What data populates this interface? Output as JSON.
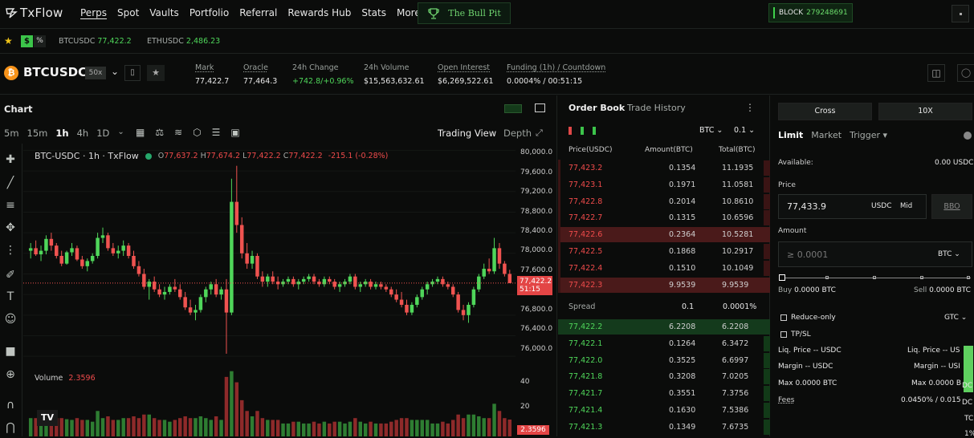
{
  "nav": {
    "logo": "TxFlow",
    "links": [
      "Perps",
      "Spot",
      "Vaults",
      "Portfolio",
      "Referral",
      "Rewards Hub",
      "Stats",
      "More"
    ],
    "bull_pit": "The Bull Pit",
    "block_label": "BLOCK",
    "block_number": "279248691"
  },
  "tickers": {
    "usd_badge": "$",
    "pct_badge": "%",
    "items": [
      {
        "symbol": "BTCUSDC",
        "price": "77,422.2"
      },
      {
        "symbol": "ETHUSDC",
        "price": "2,486.23"
      }
    ]
  },
  "market": {
    "symbol": "BTCUSDC",
    "leverage": "50x",
    "stats": [
      {
        "label": "Mark",
        "value": "77,422.7",
        "color": "#e8e8e8"
      },
      {
        "label": "Oracle",
        "value": "77,464.3",
        "color": "#e8e8e8"
      },
      {
        "label": "24h Change",
        "value": "+742.8/+0.96%",
        "color": "#4fd65a"
      },
      {
        "label": "24h Volume",
        "value": "$15,563,632.61",
        "color": "#e8e8e8"
      },
      {
        "label": "Open Interest",
        "value": "$6,269,522.61",
        "color": "#e8e8e8"
      },
      {
        "label": "Funding (1h) / Countdown",
        "value": "0.0004% / 00:51:15",
        "color": "#e8e8e8"
      }
    ]
  },
  "chart": {
    "title": "Chart",
    "intervals": [
      "5m",
      "15m",
      "1h",
      "4h",
      "1D"
    ],
    "active_interval": "1h",
    "view_tabs": [
      "Trading View",
      "Depth"
    ],
    "legend_symbol": "BTC-USDC · 1h · TxFlow",
    "ohlc": {
      "o": "77,637.2",
      "h": "77,674.2",
      "l": "77,422.2",
      "c": "77,422.2",
      "chg": "-215.1 (-0.28%)"
    },
    "price_ticks": [
      "80,000.0",
      "79,600.0",
      "79,200.0",
      "78,800.0",
      "78,400.0",
      "78,000.0",
      "77,600.0",
      "76,800.0",
      "76,400.0",
      "76,000.0"
    ],
    "current_price": "77,422.2",
    "countdown": "51:15",
    "volume_label": "Volume",
    "volume_value": "2.3596",
    "volume_ticks": [
      "40",
      "20"
    ],
    "volume_marker": "2.3596"
  },
  "chart_data": {
    "type": "candlestick",
    "ylim": [
      75800,
      80100
    ],
    "candles": [
      [
        78050,
        78200,
        77900,
        78100
      ],
      [
        78100,
        78250,
        77950,
        77980
      ],
      [
        77980,
        78150,
        77850,
        78050
      ],
      [
        78050,
        78350,
        77980,
        78280
      ],
      [
        78280,
        78400,
        78050,
        78150
      ],
      [
        78150,
        78200,
        77900,
        77950
      ],
      [
        77950,
        78050,
        77750,
        77800
      ],
      [
        77800,
        78050,
        77780,
        78020
      ],
      [
        78020,
        78200,
        77950,
        78100
      ],
      [
        78100,
        78150,
        77850,
        77880
      ],
      [
        77880,
        77950,
        77700,
        77750
      ],
      [
        77750,
        77900,
        77650,
        77850
      ],
      [
        77850,
        78000,
        77800,
        77950
      ],
      [
        77950,
        78400,
        77900,
        78300
      ],
      [
        78300,
        78500,
        78200,
        78350
      ],
      [
        78350,
        78400,
        78050,
        78100
      ],
      [
        78100,
        78200,
        77950,
        78000
      ],
      [
        78000,
        78150,
        77900,
        78050
      ],
      [
        78050,
        78250,
        77950,
        78150
      ],
      [
        78150,
        78200,
        77900,
        77950
      ],
      [
        77950,
        78050,
        77700,
        77750
      ],
      [
        77750,
        77850,
        77550,
        77600
      ],
      [
        77600,
        77700,
        77300,
        77350
      ],
      [
        77350,
        77500,
        77100,
        77450
      ],
      [
        77450,
        77550,
        77250,
        77300
      ],
      [
        77300,
        77400,
        77150,
        77200
      ],
      [
        77200,
        77350,
        77100,
        77250
      ],
      [
        77250,
        77400,
        77200,
        77350
      ],
      [
        77350,
        77500,
        77250,
        77300
      ],
      [
        77300,
        77400,
        77100,
        77150
      ],
      [
        77150,
        77250,
        76900,
        76950
      ],
      [
        76950,
        77100,
        76800,
        76850
      ],
      [
        76850,
        77000,
        76700,
        76900
      ],
      [
        76900,
        77200,
        76850,
        77150
      ],
      [
        77150,
        77350,
        77050,
        77300
      ],
      [
        77300,
        77450,
        77200,
        77400
      ],
      [
        77400,
        77500,
        77150,
        77200
      ],
      [
        77200,
        77350,
        77100,
        77300
      ],
      [
        77300,
        77500,
        76050,
        76850
      ],
      [
        76850,
        79450,
        76800,
        79000
      ],
      [
        79000,
        79700,
        78400,
        78550
      ],
      [
        78550,
        78700,
        77900,
        78000
      ],
      [
        78000,
        78200,
        77700,
        77800
      ],
      [
        77800,
        78050,
        77700,
        77950
      ],
      [
        77950,
        78000,
        77500,
        77550
      ],
      [
        77550,
        77650,
        77350,
        77450
      ],
      [
        77450,
        77600,
        77350,
        77550
      ],
      [
        77550,
        77650,
        77400,
        77450
      ],
      [
        77450,
        77550,
        77300,
        77400
      ],
      [
        77400,
        77500,
        77350,
        77450
      ],
      [
        77450,
        77550,
        77400,
        77500
      ],
      [
        77500,
        77550,
        77350,
        77400
      ],
      [
        77400,
        77500,
        77300,
        77450
      ],
      [
        77450,
        77550,
        77400,
        77500
      ],
      [
        77500,
        77600,
        77450,
        77550
      ],
      [
        77550,
        77600,
        77400,
        77450
      ],
      [
        77450,
        77500,
        77350,
        77400
      ],
      [
        77400,
        77550,
        77350,
        77500
      ],
      [
        77500,
        77550,
        77400,
        77450
      ],
      [
        77450,
        77500,
        77300,
        77350
      ],
      [
        77350,
        77450,
        77250,
        77400
      ],
      [
        77400,
        77500,
        77350,
        77450
      ],
      [
        77450,
        77600,
        77400,
        77550
      ],
      [
        77550,
        77600,
        77300,
        77350
      ],
      [
        77350,
        77450,
        77250,
        77400
      ],
      [
        77400,
        77500,
        77350,
        77450
      ],
      [
        77450,
        77500,
        77300,
        77350
      ],
      [
        77350,
        77450,
        77300,
        77400
      ],
      [
        77400,
        77450,
        77300,
        77350
      ],
      [
        77350,
        77400,
        77250,
        77300
      ],
      [
        77300,
        77350,
        77150,
        77200
      ],
      [
        77200,
        77300,
        77050,
        77100
      ],
      [
        77100,
        77250,
        76950,
        77000
      ],
      [
        77000,
        77100,
        76800,
        76850
      ],
      [
        76850,
        77050,
        76800,
        77000
      ],
      [
        77000,
        77200,
        76950,
        77150
      ],
      [
        77150,
        77350,
        77100,
        77300
      ],
      [
        77300,
        77450,
        77200,
        77400
      ],
      [
        77400,
        77500,
        77350,
        77450
      ],
      [
        77450,
        77550,
        77400,
        77500
      ],
      [
        77500,
        77550,
        77350,
        77400
      ],
      [
        77400,
        77450,
        77300,
        77350
      ],
      [
        77350,
        77400,
        77150,
        77200
      ],
      [
        77200,
        77250,
        76850,
        76900
      ],
      [
        76900,
        77000,
        76700,
        76800
      ],
      [
        76800,
        77050,
        76650,
        77000
      ],
      [
        77000,
        77350,
        76950,
        77300
      ],
      [
        77300,
        77600,
        77250,
        77550
      ],
      [
        77550,
        77800,
        77500,
        77700
      ],
      [
        77700,
        77900,
        77600,
        77650
      ],
      [
        77650,
        78300,
        77600,
        78100
      ],
      [
        78100,
        78200,
        77700,
        77800
      ],
      [
        77800,
        77850,
        77550,
        77600
      ],
      [
        77600,
        77680,
        77420,
        77422
      ]
    ],
    "volume_ylim": [
      0,
      55
    ]
  },
  "orderbook": {
    "tabs": [
      "Order Book",
      "Trade History"
    ],
    "asset": "BTC",
    "step": "0.1",
    "headers": [
      "Price(USDC)",
      "Amount(BTC)",
      "Total(BTC)"
    ],
    "asks": [
      {
        "price": "77,423.2",
        "amount": "0.1354",
        "total": "11.1935",
        "depth": 0.03
      },
      {
        "price": "77,423.1",
        "amount": "0.1971",
        "total": "11.0581",
        "depth": 0.03
      },
      {
        "price": "77,422.8",
        "amount": "0.2014",
        "total": "10.8610",
        "depth": 0.03
      },
      {
        "price": "77,422.7",
        "amount": "0.1315",
        "total": "10.6596",
        "depth": 0.03
      },
      {
        "price": "77,422.6",
        "amount": "0.2364",
        "total": "10.5281",
        "depth": 1.0
      },
      {
        "price": "77,422.5",
        "amount": "0.1868",
        "total": "10.2917",
        "depth": 0.03
      },
      {
        "price": "77,422.4",
        "amount": "0.1510",
        "total": "10.1049",
        "depth": 0.03
      },
      {
        "price": "77,422.3",
        "amount": "9.9539",
        "total": "9.9539",
        "depth": 1.0
      }
    ],
    "spread_label": "Spread",
    "spread_value": "0.1",
    "spread_pct": "0.0001%",
    "bids": [
      {
        "price": "77,422.2",
        "amount": "6.2208",
        "total": "6.2208",
        "depth": 1.0
      },
      {
        "price": "77,422.1",
        "amount": "0.1264",
        "total": "6.3472",
        "depth": 0.03
      },
      {
        "price": "77,422.0",
        "amount": "0.3525",
        "total": "6.6997",
        "depth": 0.03
      },
      {
        "price": "77,421.8",
        "amount": "0.3208",
        "total": "7.0205",
        "depth": 0.03
      },
      {
        "price": "77,421.7",
        "amount": "0.3551",
        "total": "7.3756",
        "depth": 0.03
      },
      {
        "price": "77,421.4",
        "amount": "0.1630",
        "total": "7.5386",
        "depth": 0.03
      },
      {
        "price": "77,421.3",
        "amount": "0.1349",
        "total": "7.6735",
        "depth": 0.03
      }
    ]
  },
  "trade": {
    "margin_mode": "Cross",
    "leverage": "10X",
    "order_types": [
      "Limit",
      "Market",
      "Trigger"
    ],
    "available_label": "Available:",
    "available_value": "0.00 USDC",
    "price_label": "Price",
    "price_value": "77,433.9",
    "price_unit": "USDC",
    "mid": "Mid",
    "bbo": "BBO",
    "amount_label": "Amount",
    "amount_placeholder": "≥ 0.0001",
    "amount_unit": "BTC",
    "buy_label": "Buy",
    "buy_value": "0.0000 BTC",
    "sell_label": "Sell",
    "sell_value": "0.0000 BTC",
    "reduce_only": "Reduce-only",
    "tif": "GTC",
    "tpsl": "TP/SL",
    "liq_left": "Liq. Price -- USDC",
    "liq_right": "Liq. Price -- US",
    "margin_left": "Margin -- USDC",
    "margin_right": "Margin -- USI",
    "max_left": "Max 0.0000 BTC",
    "max_right": "Max 0.0000 B",
    "fees_label": "Fees",
    "fees_value": "0.0450% / 0.015",
    "right_edge": [
      "DC",
      "DC",
      "TC",
      "1%"
    ]
  }
}
